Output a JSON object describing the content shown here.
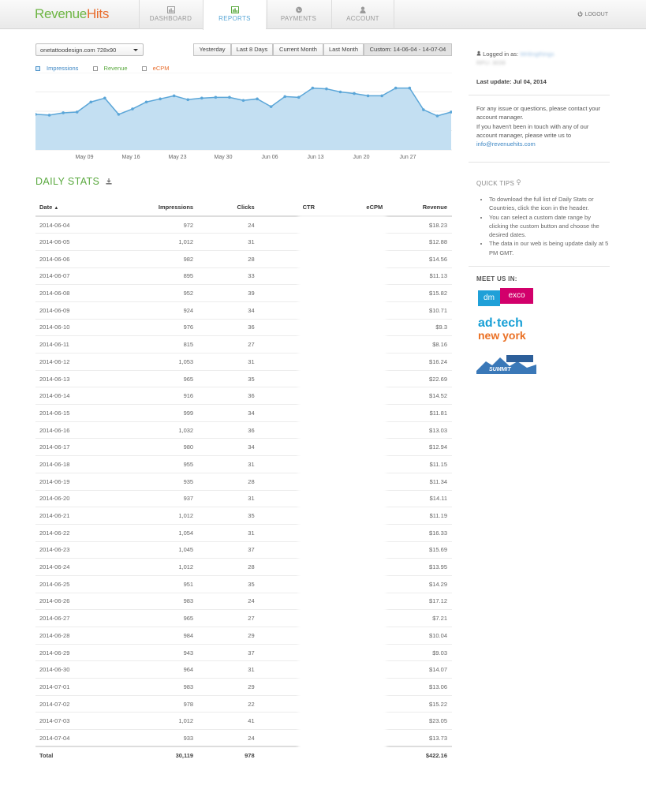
{
  "header": {
    "logo_part1": "Revenue",
    "logo_part2": "Hits",
    "nav": [
      "DASHBOARD",
      "REPORTS",
      "PAYMENTS",
      "ACCOUNT"
    ],
    "logout": "LOGOUT"
  },
  "filters": {
    "site": "onetattoodesign.com 728x90",
    "ranges": [
      "Yesterday",
      "Last 8 Days",
      "Current Month",
      "Last Month",
      "Custom: 14-06-04 - 14-07-04"
    ],
    "active_range": "Custom: 14-06-04 - 14-07-04"
  },
  "legend": [
    "Impressions",
    "Revenue",
    "eCPM"
  ],
  "chart_data": {
    "type": "area",
    "series": [
      {
        "name": "Impressions",
        "values": [
          0.46,
          0.45,
          0.48,
          0.49,
          0.62,
          0.67,
          0.46,
          0.53,
          0.62,
          0.66,
          0.7,
          0.65,
          0.67,
          0.68,
          0.68,
          0.64,
          0.66,
          0.56,
          0.69,
          0.68,
          0.8,
          0.79,
          0.75,
          0.73,
          0.7,
          0.7,
          0.8,
          0.8,
          0.52,
          0.44,
          0.49
        ]
      }
    ],
    "x_tick_labels": [
      "May 09",
      "May 16",
      "May 23",
      "May 30",
      "Jun 06",
      "Jun 13",
      "Jun 20",
      "Jun 27"
    ],
    "grid": true
  },
  "stats": {
    "title": "DAILY STATS",
    "columns": [
      "Date",
      "Impressions",
      "Clicks",
      "CTR",
      "eCPM",
      "Revenue"
    ],
    "rows": [
      [
        "2014-06-04",
        "972",
        "24",
        "$18.23"
      ],
      [
        "2014-06-05",
        "1,012",
        "31",
        "$12.88"
      ],
      [
        "2014-06-06",
        "982",
        "28",
        "$14.56"
      ],
      [
        "2014-06-07",
        "895",
        "33",
        "$11.13"
      ],
      [
        "2014-06-08",
        "952",
        "39",
        "$15.82"
      ],
      [
        "2014-06-09",
        "924",
        "34",
        "$10.71"
      ],
      [
        "2014-06-10",
        "976",
        "36",
        "$9.3"
      ],
      [
        "2014-06-11",
        "815",
        "27",
        "$8.16"
      ],
      [
        "2014-06-12",
        "1,053",
        "31",
        "$16.24"
      ],
      [
        "2014-06-13",
        "965",
        "35",
        "$22.69"
      ],
      [
        "2014-06-14",
        "916",
        "36",
        "$14.52"
      ],
      [
        "2014-06-15",
        "999",
        "34",
        "$11.81"
      ],
      [
        "2014-06-16",
        "1,032",
        "36",
        "$13.03"
      ],
      [
        "2014-06-17",
        "980",
        "34",
        "$12.94"
      ],
      [
        "2014-06-18",
        "955",
        "31",
        "$11.15"
      ],
      [
        "2014-06-19",
        "935",
        "28",
        "$11.34"
      ],
      [
        "2014-06-20",
        "937",
        "31",
        "$14.11"
      ],
      [
        "2014-06-21",
        "1,012",
        "35",
        "$11.19"
      ],
      [
        "2014-06-22",
        "1,054",
        "31",
        "$16.33"
      ],
      [
        "2014-06-23",
        "1,045",
        "37",
        "$15.69"
      ],
      [
        "2014-06-24",
        "1,012",
        "28",
        "$13.95"
      ],
      [
        "2014-06-25",
        "951",
        "35",
        "$14.29"
      ],
      [
        "2014-06-26",
        "983",
        "24",
        "$17.12"
      ],
      [
        "2014-06-27",
        "965",
        "27",
        "$7.21"
      ],
      [
        "2014-06-28",
        "984",
        "29",
        "$10.04"
      ],
      [
        "2014-06-29",
        "943",
        "37",
        "$9.03"
      ],
      [
        "2014-06-30",
        "964",
        "31",
        "$14.07"
      ],
      [
        "2014-07-01",
        "983",
        "29",
        "$13.06"
      ],
      [
        "2014-07-02",
        "978",
        "22",
        "$15.22"
      ],
      [
        "2014-07-03",
        "1,012",
        "41",
        "$23.05"
      ],
      [
        "2014-07-04",
        "933",
        "24",
        "$13.73"
      ]
    ],
    "total": [
      "Total",
      "30,119",
      "978",
      "$422.16"
    ]
  },
  "sidebar": {
    "logged_in_label": "Logged in as:",
    "logged_in_user": "Writingthings",
    "logged_in_id": "RPU: 3039",
    "last_update": "Last update: Jul 04, 2014",
    "contact_text": "For any issue or questions, please contact your account manager.",
    "contact_text2": "If you haven't been in touch with any of our account manager, please write us to",
    "email": "info@revenuehits.com",
    "quick_tips_title": "QUICK TIPS",
    "tips": [
      "To download the full list of Daily Stats or Countries, click the icon in the header.",
      "You can select a custom date range by clicking the custom button and choose the desired dates.",
      "The data in our web is being update daily at 5 PM GMT."
    ],
    "meet_us": "MEET US IN:",
    "events": [
      "dm",
      "exco",
      "ad·tech",
      "new york",
      "SUMMIT"
    ]
  },
  "colors": {
    "green": "#5aa93f",
    "orange": "#e86c2c",
    "chart_fill": "#c3dff2",
    "chart_line": "#5ba6d8"
  }
}
